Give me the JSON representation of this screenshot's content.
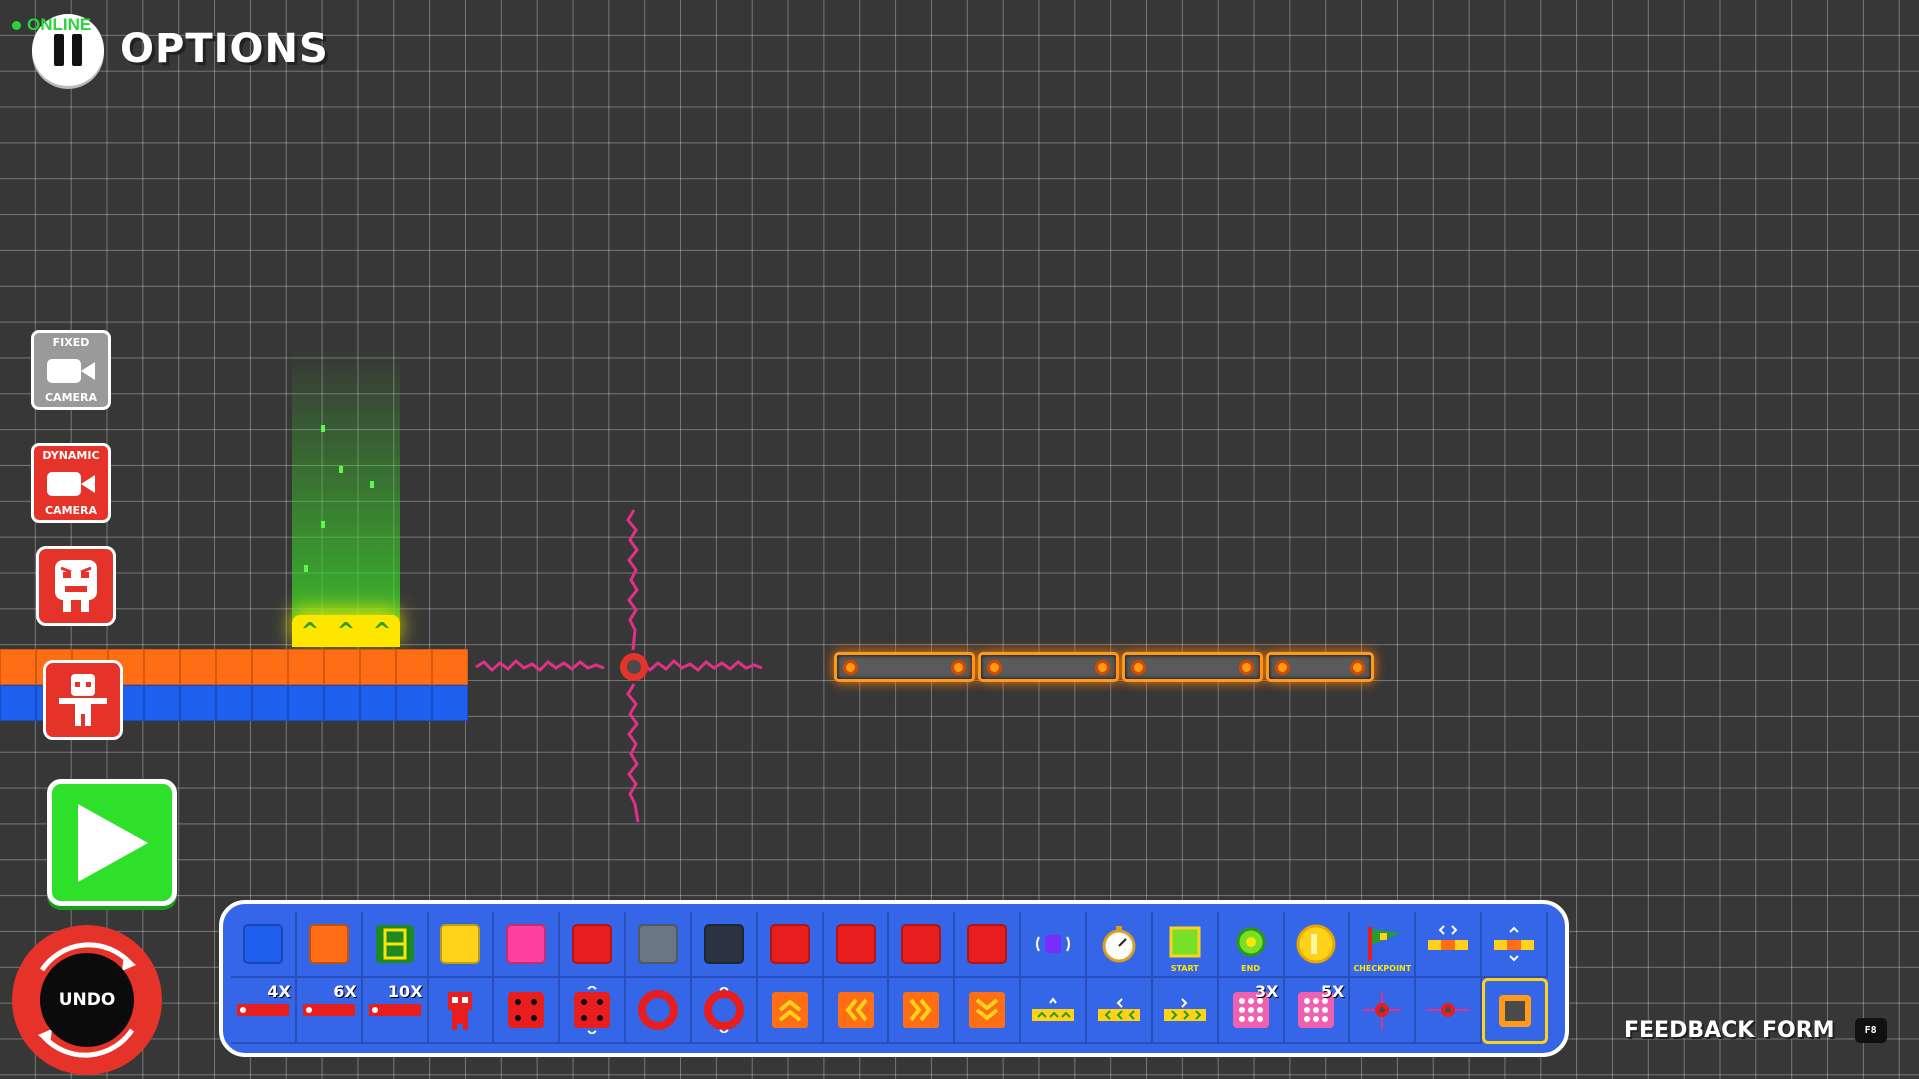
{
  "header": {
    "status_label": "ONLINE",
    "options_label": "OPTIONS"
  },
  "left_panel": {
    "fixed_camera": {
      "top": "FIXED",
      "bottom": "CAMERA"
    },
    "dynamic_camera": {
      "top": "DYNAMIC",
      "bottom": "CAMERA"
    }
  },
  "controls": {
    "undo_label": "UNDO"
  },
  "toolbar": {
    "row1_badges": [],
    "start_caption": "START",
    "end_caption": "END",
    "checkpoint_caption": "CHECKPOINT",
    "badge_4x": "4X",
    "badge_6x": "6X",
    "badge_10x": "10X",
    "badge_3x": "3X",
    "badge_5x": "5X"
  },
  "footer": {
    "feedback_label": "FEEDBACK FORM",
    "feedback_key": "F8"
  },
  "colors": {
    "background": "#373737",
    "toolbar": "#3566e8",
    "accent_red": "#e5332a",
    "play_green": "#2ee02a",
    "ground_orange": "#ff6d14",
    "ground_blue": "#1e5ff0",
    "launch_yellow": "#ffe600",
    "electric_pink": "#e0308a"
  }
}
